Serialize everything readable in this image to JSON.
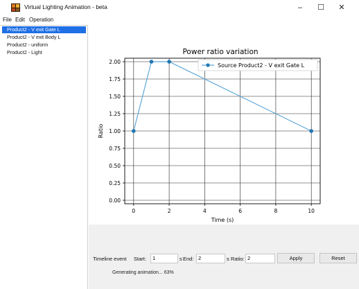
{
  "window": {
    "title": "Virtual Lighting Animation - beta",
    "minimize_glyph": "–",
    "maximize_glyph": "☐",
    "close_glyph": "✕",
    "icon": "app-icon"
  },
  "menu": [
    "File",
    "Edit",
    "Operation"
  ],
  "sidebar": {
    "items": [
      {
        "label": "Product2 - V exit Gate L",
        "selected": true
      },
      {
        "label": "Product2 - V exit Body L",
        "selected": false
      },
      {
        "label": "Product2 - uniform",
        "selected": false
      },
      {
        "label": "Product2 - Light",
        "selected": false
      }
    ]
  },
  "chart_data": {
    "type": "line",
    "title": "Power ratio variation",
    "xlabel": "Time (s)",
    "ylabel": "Ratio",
    "xlim": [
      -0.5,
      10.5
    ],
    "ylim": [
      -0.05,
      2.05
    ],
    "xticks": [
      0,
      2,
      4,
      6,
      8,
      10
    ],
    "yticks": [
      0.0,
      0.25,
      0.5,
      0.75,
      1.0,
      1.25,
      1.5,
      1.75,
      2.0
    ],
    "xtick_labels": [
      "0",
      "2",
      "4",
      "6",
      "8",
      "10"
    ],
    "ytick_labels": [
      "0.00",
      "0.25",
      "0.50",
      "0.75",
      "1.00",
      "1.25",
      "1.50",
      "1.75",
      "2.00"
    ],
    "grid": true,
    "legend_position": "top-right",
    "series": [
      {
        "name": "Source Product2 - V exit Gate L",
        "color": "#5fa8d8",
        "marker_color": "#1f77b4",
        "x": [
          0,
          1,
          2,
          10
        ],
        "y": [
          1.0,
          2.0,
          2.0,
          1.0
        ]
      }
    ]
  },
  "timeline": {
    "label": "Timeline event",
    "start_label": "Start:",
    "start_value": "1",
    "start_unit": "s",
    "end_label": "End:",
    "end_value": "2",
    "end_unit": "s",
    "ratio_label": "Ratio:",
    "ratio_value": "2",
    "apply_label": "Apply",
    "reset_label": "Reset"
  },
  "status": {
    "text": "Generating animation... 63%",
    "progress": 63
  }
}
